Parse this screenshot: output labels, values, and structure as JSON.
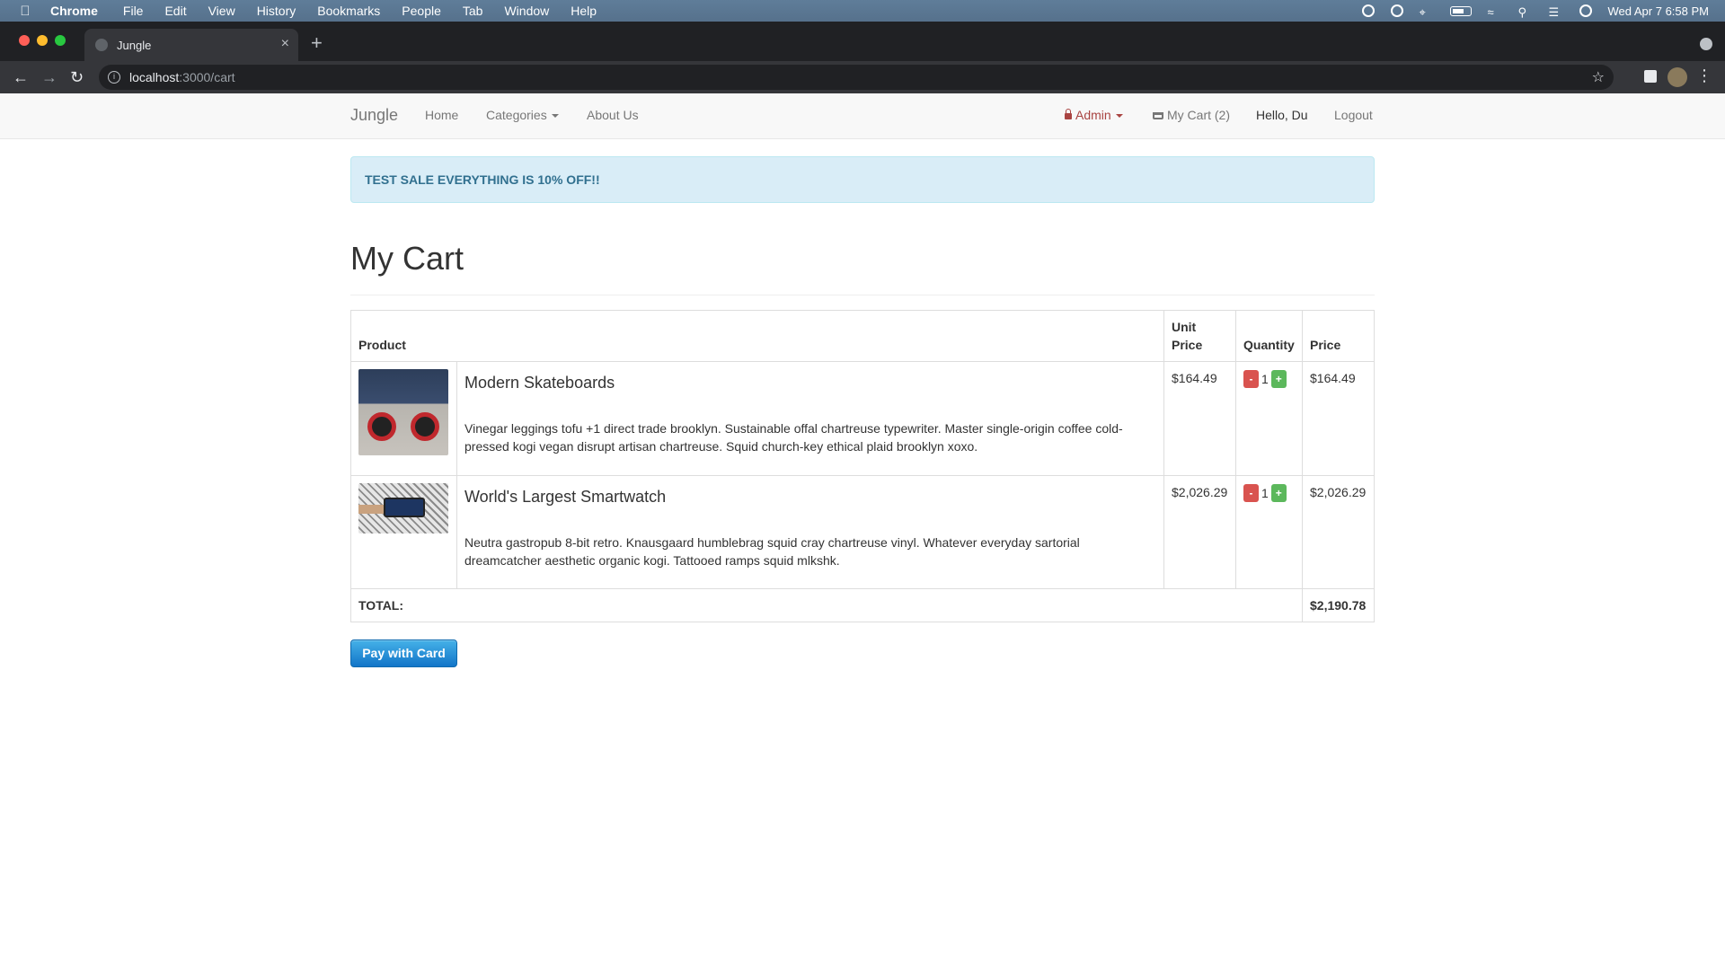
{
  "menubar": {
    "app": "Chrome",
    "items": [
      "File",
      "Edit",
      "View",
      "History",
      "Bookmarks",
      "People",
      "Tab",
      "Window",
      "Help"
    ],
    "clock": "Wed Apr 7  6:58 PM"
  },
  "browser": {
    "tab_title": "Jungle",
    "url_host": "localhost",
    "url_path": ":3000/cart"
  },
  "navbar": {
    "brand": "Jungle",
    "home": "Home",
    "categories": "Categories",
    "about": "About Us",
    "admin": "Admin",
    "cart": "My Cart (2)",
    "hello": "Hello, Du",
    "logout": "Logout"
  },
  "alert": {
    "text": "TEST SALE EVERYTHING IS 10% OFF!!"
  },
  "page": {
    "title": "My Cart"
  },
  "table": {
    "headers": {
      "product": "Product",
      "unit_price": "Unit Price",
      "quantity": "Quantity",
      "price": "Price"
    },
    "rows": [
      {
        "name": "Modern Skateboards",
        "description": "Vinegar leggings tofu +1 direct trade brooklyn. Sustainable offal chartreuse typewriter. Master single-origin coffee cold-pressed kogi vegan disrupt artisan chartreuse. Squid church-key ethical plaid brooklyn xoxo.",
        "unit_price": "$164.49",
        "quantity": "1",
        "price": "$164.49"
      },
      {
        "name": "World's Largest Smartwatch",
        "description": "Neutra gastropub 8-bit retro. Knausgaard humblebrag squid cray chartreuse vinyl. Whatever everyday sartorial dreamcatcher aesthetic organic kogi. Tattooed ramps squid mlkshk.",
        "unit_price": "$2,026.29",
        "quantity": "1",
        "price": "$2,026.29"
      }
    ],
    "minus": "-",
    "plus": "+",
    "total_label": "TOTAL:",
    "total_value": "$2,190.78"
  },
  "checkout": {
    "button": "Pay with Card"
  },
  "colors": {
    "alert_bg": "#d9edf7",
    "alert_text": "#31708f",
    "admin": "#a94442",
    "minus_btn": "#d9534f",
    "plus_btn": "#5cb85c",
    "pay_btn": "#1275c8"
  }
}
